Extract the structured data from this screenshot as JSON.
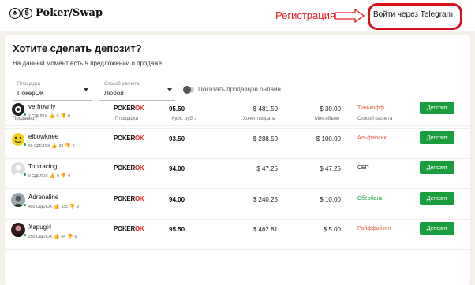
{
  "header": {
    "logo_text": "Poker/Swap",
    "registration_label": "Регистрация",
    "login_label": "Войти через Telegram"
  },
  "main": {
    "title": "Хотите сделать депозит?",
    "subtitle": "На данный момент есть 9 предложений о продаже",
    "filters": {
      "room": {
        "label": "Площадка",
        "value": "ПокерОК"
      },
      "payment": {
        "label": "Способ расчета",
        "value": "Любой"
      },
      "online_toggle_label": "Показать продавцов онлайн"
    },
    "columns": {
      "seller": "Продавец",
      "room": "Площадка",
      "rate": "Курс, руб ↓",
      "amount": "Хочет продать",
      "min": "Мин.объем",
      "payment": "Способ расчета"
    },
    "buy_label": "Депозит",
    "rows": [
      {
        "name": "verhovniy",
        "deals": "2 СДЕЛКИ",
        "likes": "0",
        "dislikes": "0",
        "room": "POKER",
        "rate": "95.50",
        "amount": "$ 481.50",
        "min": "$ 30.00",
        "payment": "Тинькофф",
        "payment_color": "#e0604a"
      },
      {
        "name": "elbowknee",
        "deals": "60 СДЕЛОК",
        "likes": "32",
        "dislikes": "0",
        "room": "POKER",
        "rate": "93.50",
        "amount": "$ 288.50",
        "min": "$ 100.00",
        "payment": "Альфабанк",
        "payment_color": "#e0604a"
      },
      {
        "name": "Toniracing",
        "deals": "0 СДЕЛОК",
        "likes": "0",
        "dislikes": "0",
        "room": "POKER",
        "rate": "94.00",
        "amount": "$ 47.25",
        "min": "$ 47.25",
        "payment": "СБП",
        "payment_color": "#222222"
      },
      {
        "name": "Adrenaline",
        "deals": "455 СДЕЛОК",
        "likes": "535",
        "dislikes": "2",
        "room": "POKER",
        "rate": "94.00",
        "amount": "$ 240.25",
        "min": "$ 10.00",
        "payment": "Сбербанк",
        "payment_color": "#1a9d3f"
      },
      {
        "name": "Xapugi4",
        "deals": "250 СДЕЛОК",
        "likes": "64",
        "dislikes": "0",
        "room": "POKER",
        "rate": "95.50",
        "amount": "$ 462.81",
        "min": "$ 5.00",
        "payment": "Райффайзен",
        "payment_color": "#e0604a"
      }
    ]
  },
  "colors": {
    "accent_red": "#e02020",
    "buy_green": "#1a9d3f"
  }
}
